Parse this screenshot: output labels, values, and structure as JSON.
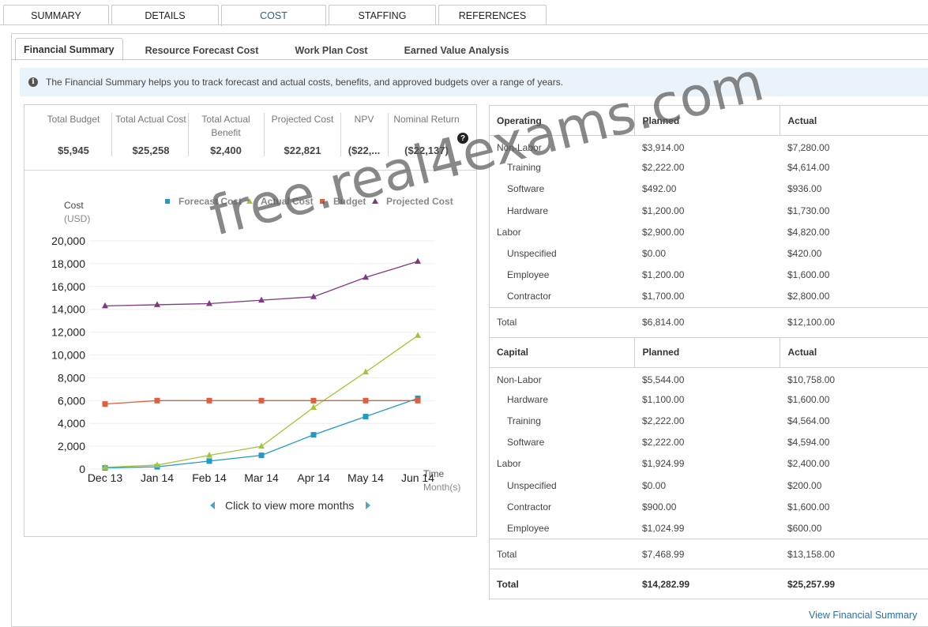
{
  "top_tabs": [
    {
      "label": "SUMMARY",
      "active": false
    },
    {
      "label": "DETAILS",
      "active": false
    },
    {
      "label": "COST",
      "active": true
    },
    {
      "label": "STAFFING",
      "active": false
    },
    {
      "label": "REFERENCES",
      "active": false
    }
  ],
  "sub_tabs": [
    {
      "label": "Financial Summary",
      "active": true
    },
    {
      "label": "Resource Forecast Cost",
      "active": false
    },
    {
      "label": "Work Plan Cost",
      "active": false
    },
    {
      "label": "Earned Value Analysis",
      "active": false
    }
  ],
  "info": {
    "icon": "info-icon",
    "text": "The Financial Summary helps you to track forecast and actual costs, benefits, and approved budgets over a range of years."
  },
  "kpis": [
    {
      "label": "Total Budget",
      "value": "$5,945"
    },
    {
      "label": "Total Actual Cost",
      "value": "$25,258"
    },
    {
      "label": "Total Actual Benefit",
      "value": "$2,400"
    },
    {
      "label": "Projected Cost",
      "value": "$22,821"
    },
    {
      "label": "NPV",
      "value": "($22,..."
    },
    {
      "label": "Nominal Return",
      "value": "($22,137)"
    }
  ],
  "chart_data": {
    "type": "line",
    "y_axis": {
      "title": "Cost",
      "unit": "(USD)",
      "min": 0,
      "max": 20000,
      "step": 2000,
      "ticks": [
        "0",
        "2,000",
        "4,000",
        "6,000",
        "8,000",
        "10,000",
        "12,000",
        "14,000",
        "16,000",
        "18,000",
        "20,000"
      ]
    },
    "x_axis": {
      "title": "Time",
      "unit": "Month(s)"
    },
    "categories": [
      "Dec 13",
      "Jan 14",
      "Feb 14",
      "Mar 14",
      "Apr 14",
      "May 14",
      "Jun 14"
    ],
    "legend_position": "top-right",
    "series": [
      {
        "name": "Forecast Cost",
        "color": "#1f9bc6",
        "marker": "square",
        "values": [
          100,
          200,
          700,
          1200,
          3000,
          4600,
          6200
        ]
      },
      {
        "name": "Actual Cost",
        "color": "#a6c43a",
        "marker": "triangle",
        "values": [
          150,
          350,
          1200,
          2000,
          5400,
          8500,
          11700
        ]
      },
      {
        "name": "Budget",
        "color": "#e25d3c",
        "marker": "square",
        "values": [
          5700,
          6000,
          6000,
          6000,
          6000,
          6000,
          6000
        ]
      },
      {
        "name": "Projected Cost",
        "color": "#7d3a82",
        "marker": "triangle",
        "values": [
          14300,
          14400,
          14500,
          14800,
          15100,
          16800,
          18200
        ]
      }
    ]
  },
  "chart_nav": {
    "label": "Click to view more months"
  },
  "operating": {
    "headers": [
      "Operating",
      "Planned",
      "Actual"
    ],
    "rows": [
      {
        "label": "Non-Labor",
        "planned": "$3,914.00",
        "actual": "$7,280.00",
        "indent": false
      },
      {
        "label": "Training",
        "planned": "$2,222.00",
        "actual": "$4,614.00",
        "indent": true
      },
      {
        "label": "Software",
        "planned": "$492.00",
        "actual": "$936.00",
        "indent": true
      },
      {
        "label": "Hardware",
        "planned": "$1,200.00",
        "actual": "$1,730.00",
        "indent": true
      },
      {
        "label": "Labor",
        "planned": "$2,900.00",
        "actual": "$4,820.00",
        "indent": false
      },
      {
        "label": "Unspecified",
        "planned": "$0.00",
        "actual": "$420.00",
        "indent": true
      },
      {
        "label": "Employee",
        "planned": "$1,200.00",
        "actual": "$1,600.00",
        "indent": true
      },
      {
        "label": "Contractor",
        "planned": "$1,700.00",
        "actual": "$2,800.00",
        "indent": true
      }
    ],
    "total": {
      "label": "Total",
      "planned": "$6,814.00",
      "actual": "$12,100.00"
    }
  },
  "capital": {
    "headers": [
      "Capital",
      "Planned",
      "Actual"
    ],
    "rows": [
      {
        "label": "Non-Labor",
        "planned": "$5,544.00",
        "actual": "$10,758.00",
        "indent": false
      },
      {
        "label": "Hardware",
        "planned": "$1,100.00",
        "actual": "$1,600.00",
        "indent": true
      },
      {
        "label": "Training",
        "planned": "$2,222.00",
        "actual": "$4,564.00",
        "indent": true
      },
      {
        "label": "Software",
        "planned": "$2,222.00",
        "actual": "$4,594.00",
        "indent": true
      },
      {
        "label": "Labor",
        "planned": "$1,924.99",
        "actual": "$2,400.00",
        "indent": false
      },
      {
        "label": "Unspecified",
        "planned": "$0.00",
        "actual": "$200.00",
        "indent": true
      },
      {
        "label": "Contractor",
        "planned": "$900.00",
        "actual": "$1,600.00",
        "indent": true
      },
      {
        "label": "Employee",
        "planned": "$1,024.99",
        "actual": "$600.00",
        "indent": true
      }
    ],
    "total": {
      "label": "Total",
      "planned": "$7,468.99",
      "actual": "$13,158.00"
    }
  },
  "grand_total": {
    "label": "Total",
    "planned": "$14,282.99",
    "actual": "$25,257.99"
  },
  "view_link": "View Financial Summary",
  "watermark": "free.real4exams.com"
}
